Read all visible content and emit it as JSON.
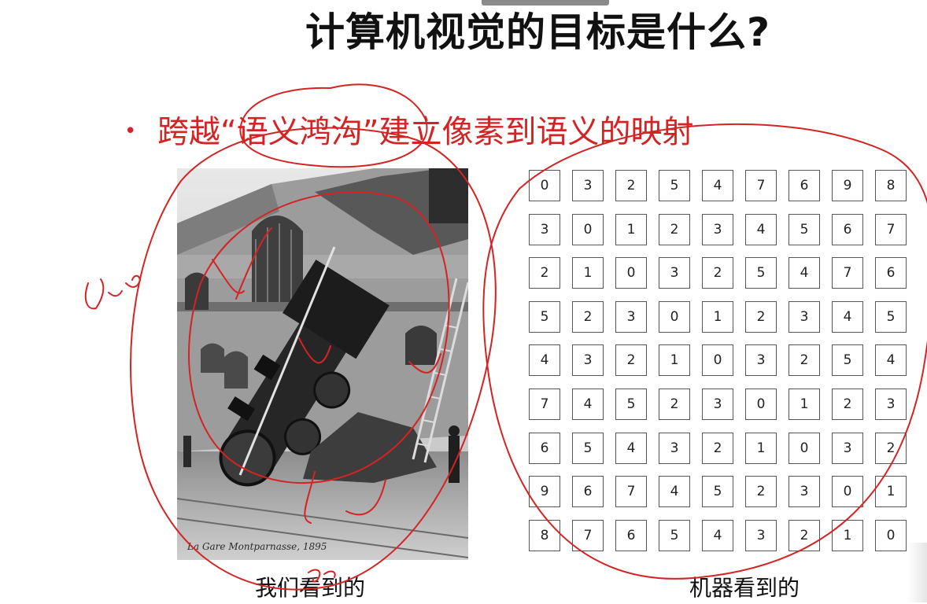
{
  "slide": {
    "title": "计算机视觉的目标是什么?",
    "bullet_symbol": "•",
    "bullet": "跨越“语义鸿沟”建立像素到语义的映射",
    "photo_caption": "La Gare Montparnasse, 1895",
    "left_label": "我们看到的",
    "right_label": "机器看到的",
    "accent_color": "#d42323"
  },
  "pixel_grid": [
    [
      0,
      3,
      2,
      5,
      4,
      7,
      6,
      9,
      8
    ],
    [
      3,
      0,
      1,
      2,
      3,
      4,
      5,
      6,
      7
    ],
    [
      2,
      1,
      0,
      3,
      2,
      5,
      4,
      7,
      6
    ],
    [
      5,
      2,
      3,
      0,
      1,
      2,
      3,
      4,
      5
    ],
    [
      4,
      3,
      2,
      1,
      0,
      3,
      2,
      5,
      4
    ],
    [
      7,
      4,
      5,
      2,
      3,
      0,
      1,
      2,
      3
    ],
    [
      6,
      5,
      4,
      3,
      2,
      1,
      0,
      3,
      2
    ],
    [
      9,
      6,
      7,
      4,
      5,
      2,
      3,
      0,
      1
    ],
    [
      8,
      7,
      6,
      5,
      4,
      3,
      2,
      1,
      0
    ]
  ]
}
